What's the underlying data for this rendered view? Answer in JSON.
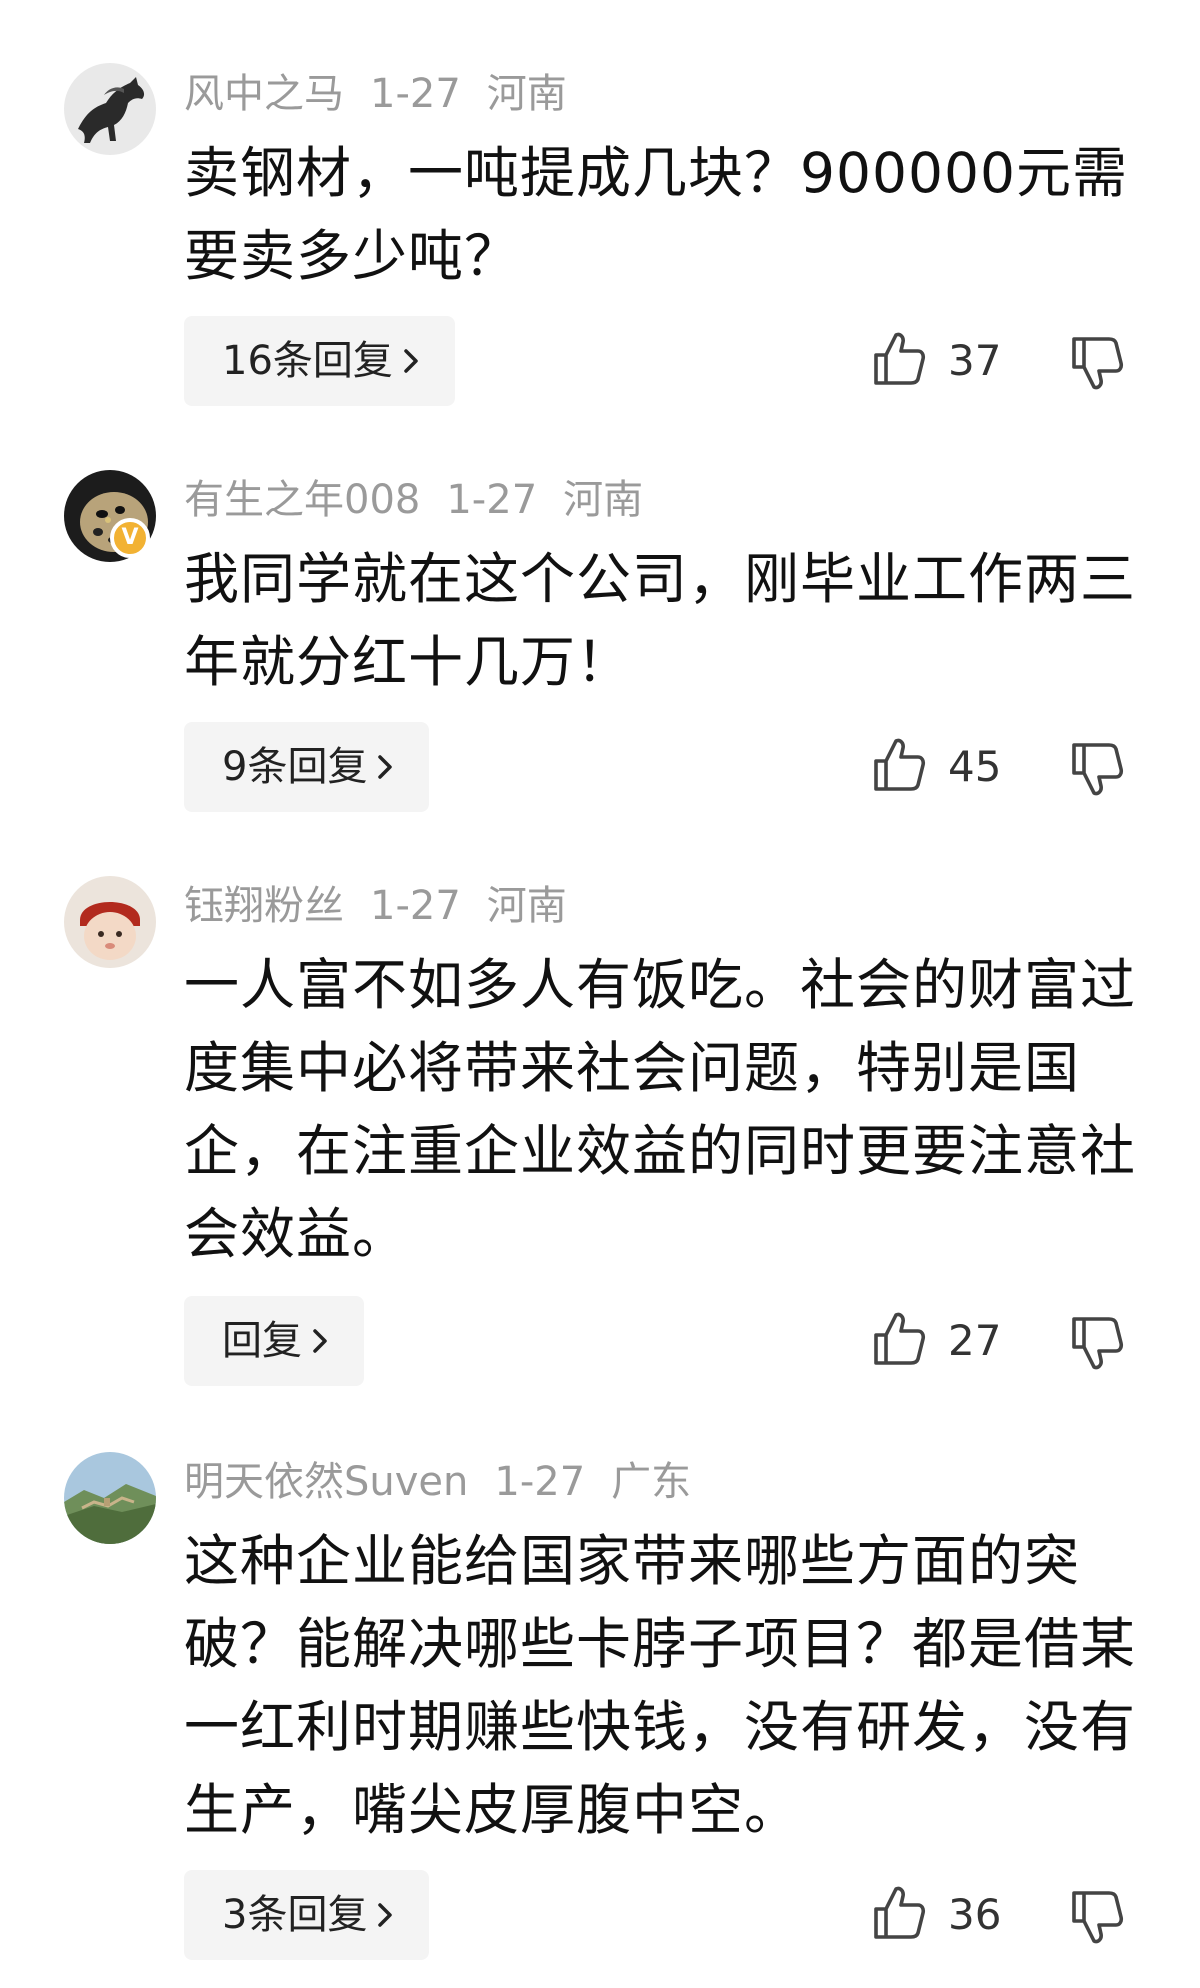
{
  "comments": [
    {
      "username": "风中之马",
      "date": "1-27",
      "location": "河南",
      "text": "卖钢材，一吨提成几块？900000元需要卖多少吨？",
      "reply_label": "16条回复",
      "likes": "37",
      "avatar_icon": "horse-ink-painting-avatar",
      "verified": false
    },
    {
      "username": "有生之年008",
      "date": "1-27",
      "location": "河南",
      "text": "我同学就在这个公司，刚毕业工作两三年就分红十几万！",
      "reply_label": "9条回复",
      "likes": "45",
      "avatar_icon": "leopard-avatar",
      "verified": true,
      "verified_badge": "V"
    },
    {
      "username": "钰翔粉丝",
      "date": "1-27",
      "location": "河南",
      "text": "一人富不如多人有饭吃。社会的财富过度集中必将带来社会问题，特别是国企，在注重企业效益的同时更要注意社会效益。",
      "reply_label": "回复",
      "likes": "27",
      "avatar_icon": "baby-in-red-hat-avatar",
      "verified": false
    },
    {
      "username": "明天依然Suven",
      "date": "1-27",
      "location": "广东",
      "text": "这种企业能给国家带来哪些方面的突破？能解决哪些卡脖子项目？都是借某一红利时期赚些快钱，没有研发，没有生产，嘴尖皮厚腹中空。",
      "reply_label": "3条回复",
      "likes": "36",
      "avatar_icon": "great-wall-landscape-avatar",
      "verified": false
    }
  ],
  "icons": {
    "like": "thumbs-up-icon",
    "dislike": "thumbs-down-icon",
    "chevron": "chevron-right-icon"
  },
  "colors": {
    "meta_text": "#9a9a9a",
    "body_text": "#111111",
    "reply_bg": "#f4f4f4",
    "verified_badge": "#f2b233"
  }
}
